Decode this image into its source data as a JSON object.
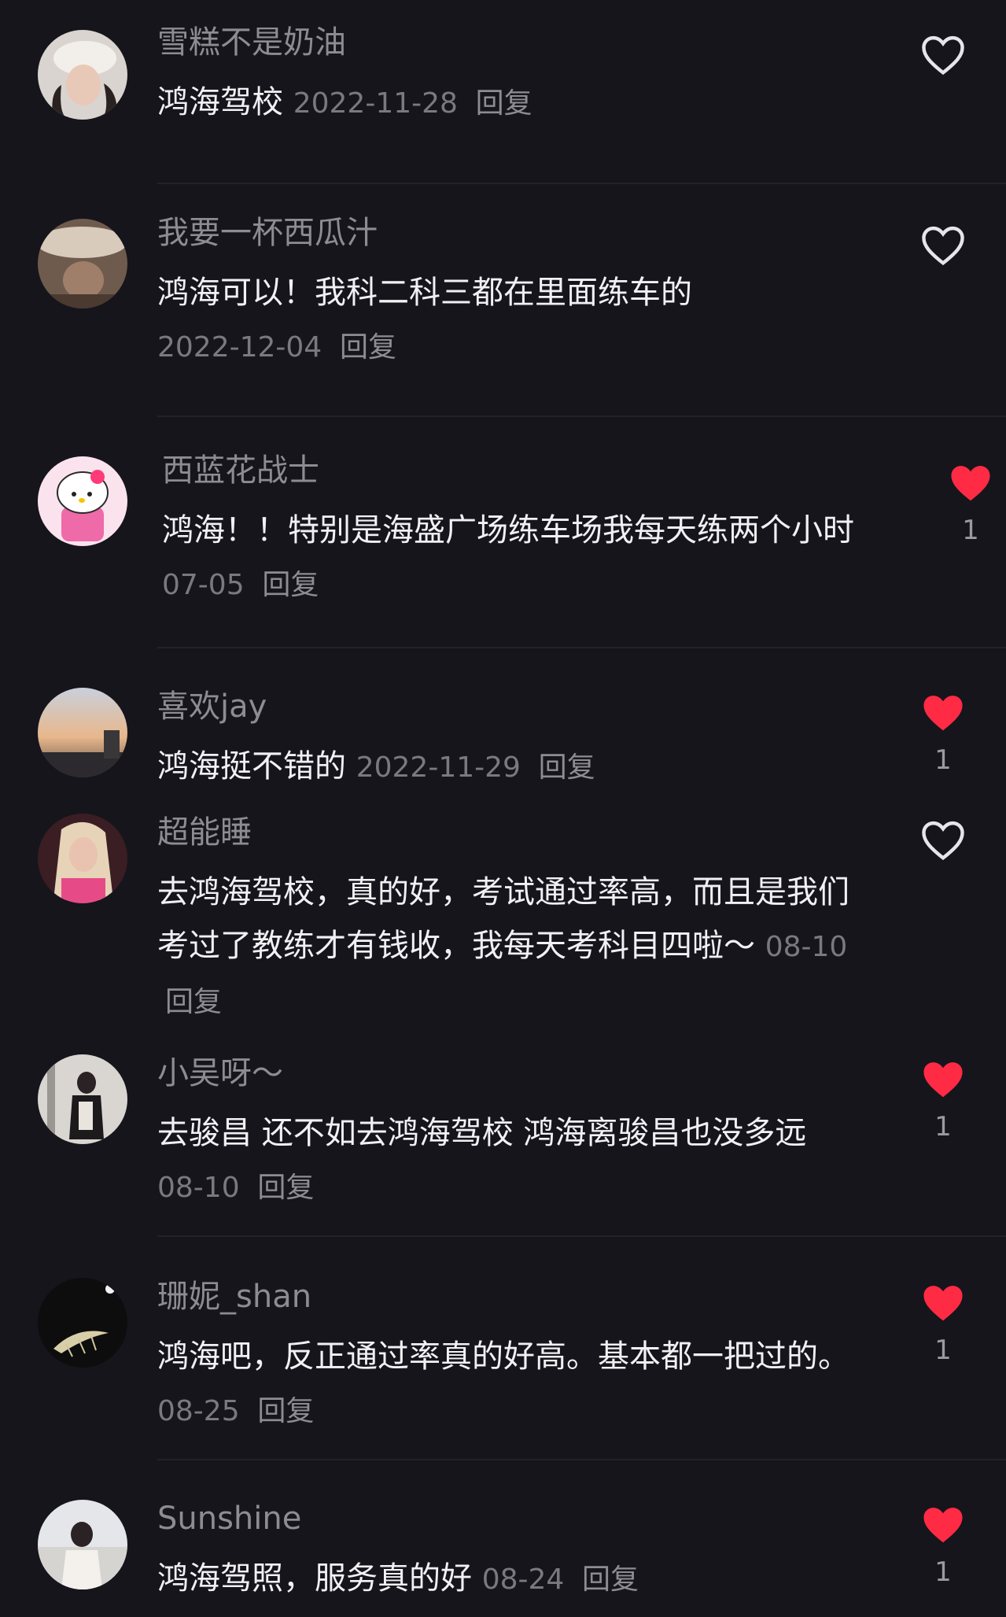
{
  "colors": {
    "background": "#16151c",
    "like_active": "#ff2b44",
    "like_inactive": "#e6e6ea"
  },
  "comments": [
    {
      "username": "雪糕不是奶油",
      "text": "鸿海驾校",
      "date": "2022-11-28",
      "reply": "回复",
      "liked": false,
      "likes": ""
    },
    {
      "username": "我要一杯西瓜汁",
      "text": "鸿海可以！我科二科三都在里面练车的",
      "date": "2022-12-04",
      "reply": "回复",
      "liked": false,
      "likes": ""
    },
    {
      "username": "西蓝花战士",
      "text": "鸿海！！特别是海盛广场练车场我每天练两个小时",
      "date": "07-05",
      "reply": "回复",
      "liked": true,
      "likes": "1"
    },
    {
      "username": "喜欢jay",
      "text": "鸿海挺不错的",
      "date": "2022-11-29",
      "reply": "回复",
      "liked": true,
      "likes": "1"
    },
    {
      "username": "超能睡",
      "text": "去鸿海驾校，真的好，考试通过率高，而且是我们考过了教练才有钱收，我每天考科目四啦～",
      "date": "08-10",
      "reply": "回复",
      "liked": false,
      "likes": ""
    },
    {
      "username": "小吴呀～",
      "text": "去骏昌 还不如去鸿海驾校 鸿海离骏昌也没多远",
      "date": "08-10",
      "reply": "回复",
      "liked": true,
      "likes": "1"
    },
    {
      "username": "珊妮_shan",
      "text": "鸿海吧，反正通过率真的好高。基本都一把过的。",
      "date": "08-25",
      "reply": "回复",
      "liked": true,
      "likes": "1"
    },
    {
      "username": "Sunshine",
      "text": "鸿海驾照，服务真的好",
      "date": "08-24",
      "reply": "回复",
      "liked": true,
      "likes": "1"
    }
  ]
}
